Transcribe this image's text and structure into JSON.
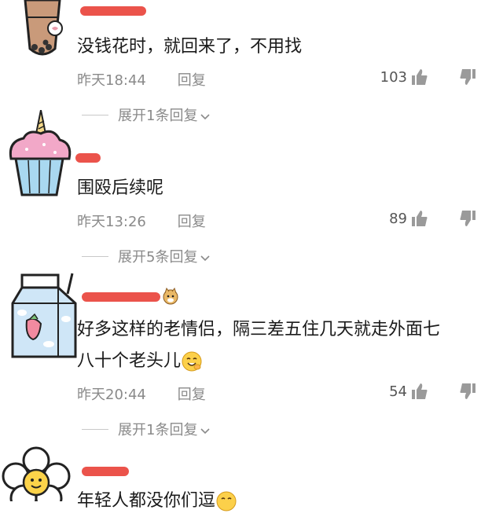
{
  "comments": [
    {
      "text": "没钱花时，就回来了，不用找",
      "time": "昨天18:44",
      "reply_label": "回复",
      "likes": "103",
      "expand_label": "展开1条回复"
    },
    {
      "text": "围殴后续呢",
      "time": "昨天13:26",
      "reply_label": "回复",
      "likes": "89",
      "expand_label": "展开5条回复"
    },
    {
      "text_line1": "好多这样的老情侣，隔三差五住几天就走外面七",
      "text_line2": "八十个老头儿",
      "time": "昨天20:44",
      "reply_label": "回复",
      "likes": "54",
      "expand_label": "展开1条回复"
    },
    {
      "text": "年轻人都没你们逗"
    }
  ],
  "icons": {
    "like": "thumb-up-icon",
    "dislike": "thumb-down-icon",
    "expand": "chevron-down-icon"
  },
  "colors": {
    "redaction": "#e8352b",
    "meta_text": "#8a8a8a",
    "body_text": "#1a1a1a"
  }
}
